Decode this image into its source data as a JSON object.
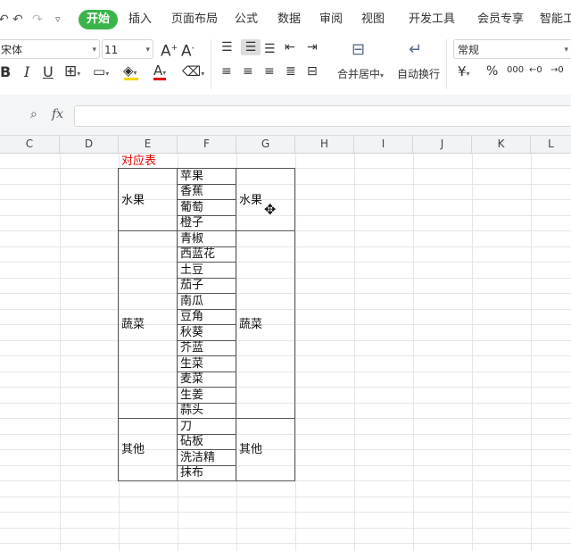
{
  "tabs": [
    "开始",
    "插入",
    "页面布局",
    "公式",
    "数据",
    "审阅",
    "视图",
    "开发工具",
    "会员专享",
    "智能工"
  ],
  "font": {
    "name": "宋体",
    "size": "11"
  },
  "number_format": "常规",
  "ribbon_labels": {
    "merge_center": "合并居中",
    "wrap_text": "自动换行"
  },
  "toolbar_text": {
    "bold": "B",
    "italic": "I",
    "underline": "U",
    "font_grow": "A",
    "font_shrink": "A",
    "font_color": "A",
    "percent": "%",
    "thousands": "000",
    "yuan": "¥"
  },
  "formula_bar": {
    "fx": "fx",
    "value": ""
  },
  "columns": [
    "C",
    "D",
    "E",
    "F",
    "G",
    "H",
    "I",
    "J",
    "K",
    "L"
  ],
  "sheet": {
    "title": "对应表",
    "groups": [
      {
        "category": "水果",
        "category_g": "水果",
        "items": [
          "苹果",
          "香蕉",
          "葡萄",
          "橙子"
        ]
      },
      {
        "category": "蔬菜",
        "category_g": "蔬菜",
        "items": [
          "青椒",
          "西蓝花",
          "土豆",
          "茄子",
          "南瓜",
          "豆角",
          "秋葵",
          "芥蓝",
          "生菜",
          "麦菜",
          "生姜",
          "蒜头"
        ]
      },
      {
        "category": "其他",
        "category_g": "其他",
        "items": [
          "刀",
          "砧板",
          "洗洁精",
          "抹布"
        ]
      }
    ]
  },
  "colors": {
    "active_tab": "#3bb54a",
    "title_text": "#e00000",
    "font_color_bar": "#e00000",
    "fill_color_bar": "#f5d400"
  }
}
